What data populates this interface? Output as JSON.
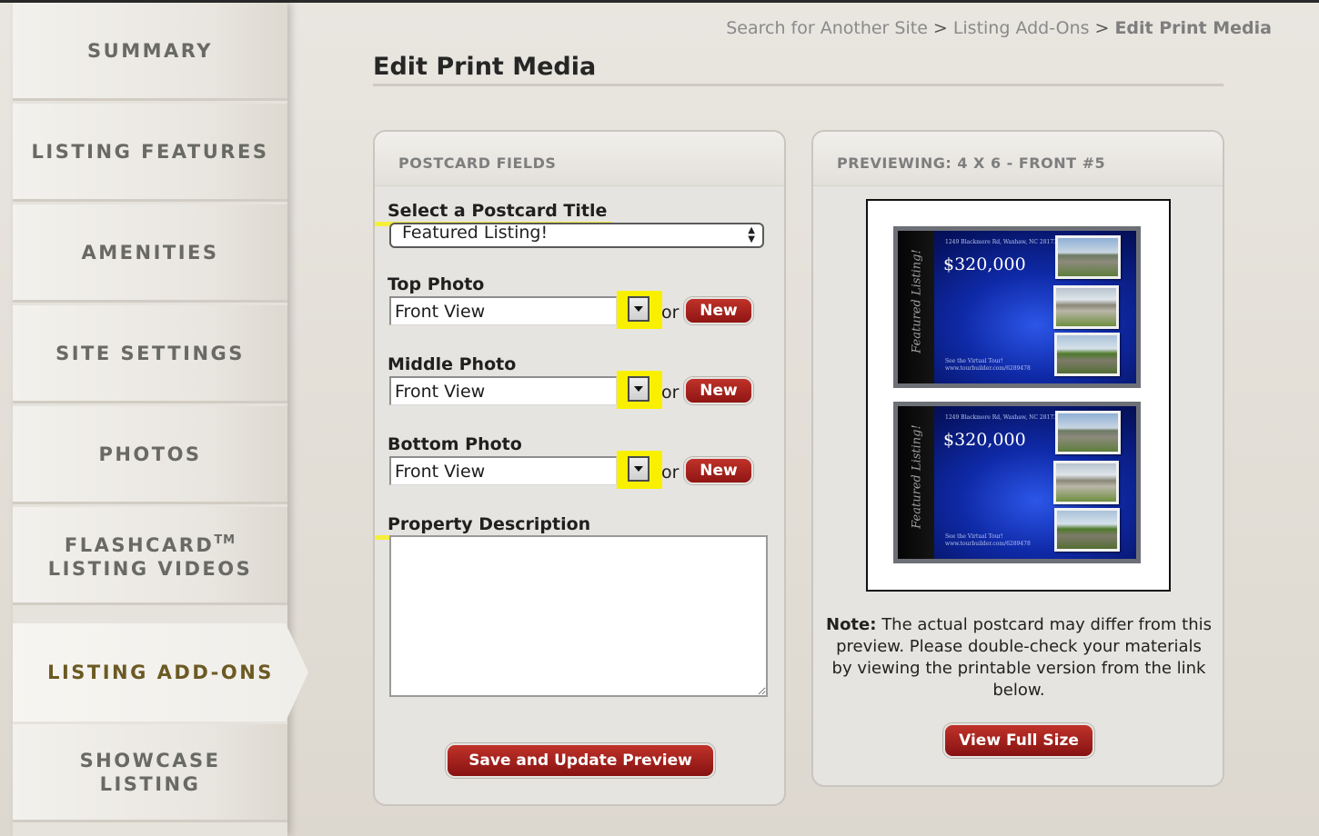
{
  "sidebar": {
    "items": [
      {
        "label": "SUMMARY"
      },
      {
        "label": "LISTING FEATURES"
      },
      {
        "label": "AMENITIES"
      },
      {
        "label": "SITE SETTINGS"
      },
      {
        "label": "PHOTOS"
      },
      {
        "label": "FLASHCARD",
        "sup": "TM",
        "label2": "LISTING VIDEOS"
      },
      {
        "label": "LISTING ADD-ONS",
        "active": true
      },
      {
        "label": "SHOWCASE",
        "label2": "LISTING"
      }
    ]
  },
  "breadcrumb": {
    "items": [
      "Search for Another Site",
      "Listing Add-Ons"
    ],
    "separator": ">",
    "current": "Edit Print Media"
  },
  "page": {
    "title": "Edit Print Media"
  },
  "postcard_fields": {
    "header": "POSTCARD FIELDS",
    "title_label": "Select a Postcard Title",
    "title_value": "Featured Listing!",
    "top_photo": {
      "label": "Top Photo",
      "value": "Front View",
      "or": "or",
      "new_label": "New"
    },
    "middle_photo": {
      "label": "Middle Photo",
      "value": "Front View",
      "or": "or",
      "new_label": "New"
    },
    "bottom_photo": {
      "label": "Bottom Photo",
      "value": "Front View",
      "or": "or",
      "new_label": "New"
    },
    "description_label": "Property Description",
    "description_value": "",
    "save_label": "Save and Update Preview"
  },
  "preview": {
    "header": "PREVIEWING: 4 X 6 - FRONT #5",
    "postcard": {
      "featured": "Featured Listing!",
      "address": "1249 Blackmore Rd, Waxhaw, NC 28173",
      "price": "$320,000",
      "tour_line1": "See the Virtual Tour!",
      "tour_line2": "www.tourbuilder.com/6289478"
    },
    "note_bold": "Note:",
    "note_text": "The actual postcard may differ from this preview. Please double-check your materials by viewing the printable version from the link below.",
    "view_label": "View Full Size"
  },
  "colors": {
    "accent_button": "#a81e1a",
    "active_nav_text": "#6b5a23",
    "highlight": "#f5ef3a",
    "postcard_blue": "#0f2aa8"
  },
  "icons": {
    "dropdown": "chevron-down-icon",
    "select_arrows": "updown-arrows-icon"
  }
}
